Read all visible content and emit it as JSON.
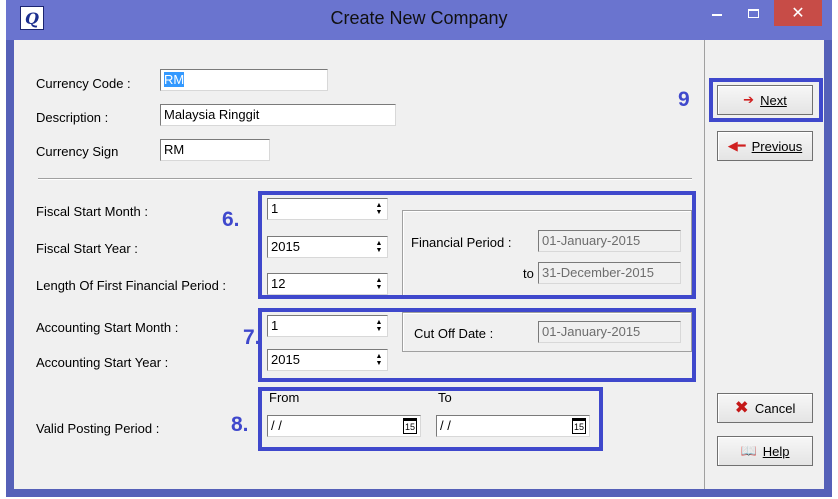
{
  "window": {
    "title": "Create New Company",
    "close_glyph": "✕"
  },
  "currency": {
    "code_label": "Currency Code :",
    "code_value": "RM",
    "description_label": "Description :",
    "description_value": "Malaysia Ringgit",
    "sign_label": "Currency Sign",
    "sign_value": "RM"
  },
  "fiscal": {
    "start_month_label": "Fiscal Start Month :",
    "start_month_value": "1",
    "start_year_label": "Fiscal Start Year :",
    "start_year_value": "2015",
    "length_label": "Length Of First Financial Period :",
    "length_value": "12",
    "financial_period_label": "Financial Period :",
    "financial_period_from": "01-January-2015",
    "to_label": "to",
    "financial_period_to": "31-December-2015"
  },
  "accounting": {
    "start_month_label": "Accounting Start Month :",
    "start_month_value": "1",
    "start_year_label": "Accounting Start Year :",
    "start_year_value": "2015",
    "cutoff_label": "Cut Off Date :",
    "cutoff_value": "01-January-2015"
  },
  "posting": {
    "label": "Valid Posting Period :",
    "from_label": "From",
    "from_value": " / /",
    "to_label": "To",
    "to_value": " / /",
    "calendar_glyph": "15"
  },
  "buttons": {
    "next_label": "Next",
    "previous_label": "Previous",
    "cancel_label": "Cancel",
    "help_label": "Help"
  },
  "annotations": {
    "six": "6.",
    "seven": "7.",
    "eight": "8.",
    "nine": "9"
  },
  "colors": {
    "annotation": "#3f48cc",
    "titlebar": "#6a74cf",
    "close": "#c74c47",
    "selection": "#3399ff"
  }
}
